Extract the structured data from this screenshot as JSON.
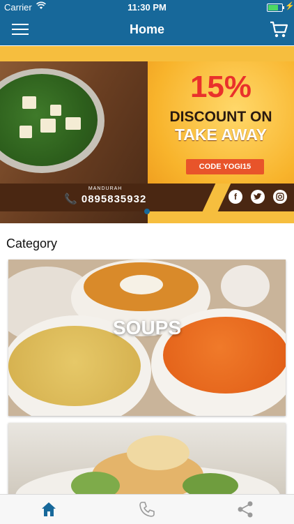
{
  "status_bar": {
    "carrier": "Carrier",
    "time": "11:30 PM"
  },
  "nav": {
    "title": "Home",
    "menu_icon": "hamburger-menu-icon",
    "cart_icon": "shopping-cart-icon"
  },
  "banner": {
    "discount": "15%",
    "line1": "DISCOUNT ON",
    "line2": "TAKE AWAY",
    "code": "CODE YOGI15",
    "location": "MANDURAH",
    "phone": "0895835932",
    "social": [
      "f",
      "t",
      "ig"
    ],
    "pager": {
      "count": 1,
      "active": 1
    }
  },
  "section": {
    "title": "Category"
  },
  "categories": [
    {
      "label": "SOUPS"
    },
    {
      "label": ""
    }
  ],
  "tab_bar": {
    "items": [
      {
        "icon": "home-icon",
        "active": true
      },
      {
        "icon": "phone-icon",
        "active": false
      },
      {
        "icon": "share-icon",
        "active": false
      }
    ]
  },
  "colors": {
    "primary": "#17689a",
    "banner_yellow": "#f6be3e",
    "promo_red": "#e9312b"
  }
}
